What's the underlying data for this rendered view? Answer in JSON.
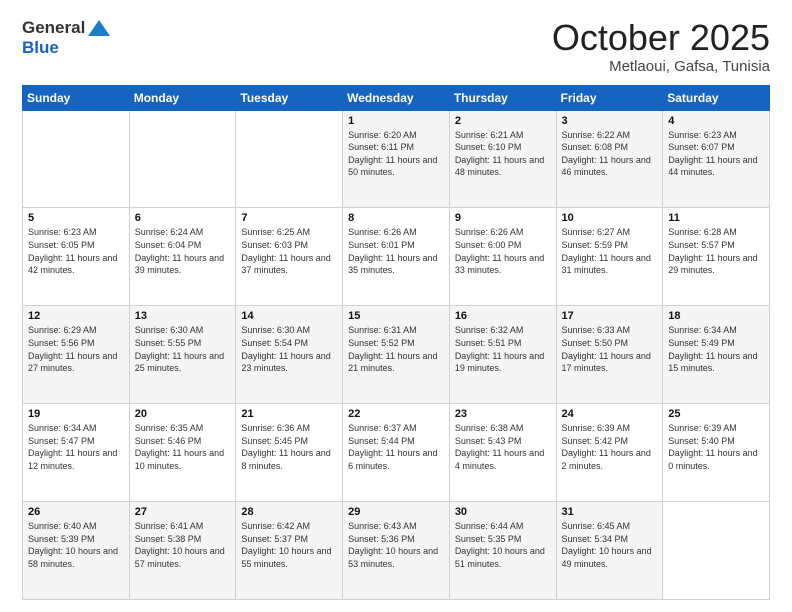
{
  "header": {
    "logo_general": "General",
    "logo_blue": "Blue",
    "month": "October 2025",
    "location": "Metlaoui, Gafsa, Tunisia"
  },
  "days_of_week": [
    "Sunday",
    "Monday",
    "Tuesday",
    "Wednesday",
    "Thursday",
    "Friday",
    "Saturday"
  ],
  "weeks": [
    [
      {
        "day": "",
        "sunrise": "",
        "sunset": "",
        "daylight": ""
      },
      {
        "day": "",
        "sunrise": "",
        "sunset": "",
        "daylight": ""
      },
      {
        "day": "",
        "sunrise": "",
        "sunset": "",
        "daylight": ""
      },
      {
        "day": "1",
        "sunrise": "Sunrise: 6:20 AM",
        "sunset": "Sunset: 6:11 PM",
        "daylight": "Daylight: 11 hours and 50 minutes."
      },
      {
        "day": "2",
        "sunrise": "Sunrise: 6:21 AM",
        "sunset": "Sunset: 6:10 PM",
        "daylight": "Daylight: 11 hours and 48 minutes."
      },
      {
        "day": "3",
        "sunrise": "Sunrise: 6:22 AM",
        "sunset": "Sunset: 6:08 PM",
        "daylight": "Daylight: 11 hours and 46 minutes."
      },
      {
        "day": "4",
        "sunrise": "Sunrise: 6:23 AM",
        "sunset": "Sunset: 6:07 PM",
        "daylight": "Daylight: 11 hours and 44 minutes."
      }
    ],
    [
      {
        "day": "5",
        "sunrise": "Sunrise: 6:23 AM",
        "sunset": "Sunset: 6:05 PM",
        "daylight": "Daylight: 11 hours and 42 minutes."
      },
      {
        "day": "6",
        "sunrise": "Sunrise: 6:24 AM",
        "sunset": "Sunset: 6:04 PM",
        "daylight": "Daylight: 11 hours and 39 minutes."
      },
      {
        "day": "7",
        "sunrise": "Sunrise: 6:25 AM",
        "sunset": "Sunset: 6:03 PM",
        "daylight": "Daylight: 11 hours and 37 minutes."
      },
      {
        "day": "8",
        "sunrise": "Sunrise: 6:26 AM",
        "sunset": "Sunset: 6:01 PM",
        "daylight": "Daylight: 11 hours and 35 minutes."
      },
      {
        "day": "9",
        "sunrise": "Sunrise: 6:26 AM",
        "sunset": "Sunset: 6:00 PM",
        "daylight": "Daylight: 11 hours and 33 minutes."
      },
      {
        "day": "10",
        "sunrise": "Sunrise: 6:27 AM",
        "sunset": "Sunset: 5:59 PM",
        "daylight": "Daylight: 11 hours and 31 minutes."
      },
      {
        "day": "11",
        "sunrise": "Sunrise: 6:28 AM",
        "sunset": "Sunset: 5:57 PM",
        "daylight": "Daylight: 11 hours and 29 minutes."
      }
    ],
    [
      {
        "day": "12",
        "sunrise": "Sunrise: 6:29 AM",
        "sunset": "Sunset: 5:56 PM",
        "daylight": "Daylight: 11 hours and 27 minutes."
      },
      {
        "day": "13",
        "sunrise": "Sunrise: 6:30 AM",
        "sunset": "Sunset: 5:55 PM",
        "daylight": "Daylight: 11 hours and 25 minutes."
      },
      {
        "day": "14",
        "sunrise": "Sunrise: 6:30 AM",
        "sunset": "Sunset: 5:54 PM",
        "daylight": "Daylight: 11 hours and 23 minutes."
      },
      {
        "day": "15",
        "sunrise": "Sunrise: 6:31 AM",
        "sunset": "Sunset: 5:52 PM",
        "daylight": "Daylight: 11 hours and 21 minutes."
      },
      {
        "day": "16",
        "sunrise": "Sunrise: 6:32 AM",
        "sunset": "Sunset: 5:51 PM",
        "daylight": "Daylight: 11 hours and 19 minutes."
      },
      {
        "day": "17",
        "sunrise": "Sunrise: 6:33 AM",
        "sunset": "Sunset: 5:50 PM",
        "daylight": "Daylight: 11 hours and 17 minutes."
      },
      {
        "day": "18",
        "sunrise": "Sunrise: 6:34 AM",
        "sunset": "Sunset: 5:49 PM",
        "daylight": "Daylight: 11 hours and 15 minutes."
      }
    ],
    [
      {
        "day": "19",
        "sunrise": "Sunrise: 6:34 AM",
        "sunset": "Sunset: 5:47 PM",
        "daylight": "Daylight: 11 hours and 12 minutes."
      },
      {
        "day": "20",
        "sunrise": "Sunrise: 6:35 AM",
        "sunset": "Sunset: 5:46 PM",
        "daylight": "Daylight: 11 hours and 10 minutes."
      },
      {
        "day": "21",
        "sunrise": "Sunrise: 6:36 AM",
        "sunset": "Sunset: 5:45 PM",
        "daylight": "Daylight: 11 hours and 8 minutes."
      },
      {
        "day": "22",
        "sunrise": "Sunrise: 6:37 AM",
        "sunset": "Sunset: 5:44 PM",
        "daylight": "Daylight: 11 hours and 6 minutes."
      },
      {
        "day": "23",
        "sunrise": "Sunrise: 6:38 AM",
        "sunset": "Sunset: 5:43 PM",
        "daylight": "Daylight: 11 hours and 4 minutes."
      },
      {
        "day": "24",
        "sunrise": "Sunrise: 6:39 AM",
        "sunset": "Sunset: 5:42 PM",
        "daylight": "Daylight: 11 hours and 2 minutes."
      },
      {
        "day": "25",
        "sunrise": "Sunrise: 6:39 AM",
        "sunset": "Sunset: 5:40 PM",
        "daylight": "Daylight: 11 hours and 0 minutes."
      }
    ],
    [
      {
        "day": "26",
        "sunrise": "Sunrise: 6:40 AM",
        "sunset": "Sunset: 5:39 PM",
        "daylight": "Daylight: 10 hours and 58 minutes."
      },
      {
        "day": "27",
        "sunrise": "Sunrise: 6:41 AM",
        "sunset": "Sunset: 5:38 PM",
        "daylight": "Daylight: 10 hours and 57 minutes."
      },
      {
        "day": "28",
        "sunrise": "Sunrise: 6:42 AM",
        "sunset": "Sunset: 5:37 PM",
        "daylight": "Daylight: 10 hours and 55 minutes."
      },
      {
        "day": "29",
        "sunrise": "Sunrise: 6:43 AM",
        "sunset": "Sunset: 5:36 PM",
        "daylight": "Daylight: 10 hours and 53 minutes."
      },
      {
        "day": "30",
        "sunrise": "Sunrise: 6:44 AM",
        "sunset": "Sunset: 5:35 PM",
        "daylight": "Daylight: 10 hours and 51 minutes."
      },
      {
        "day": "31",
        "sunrise": "Sunrise: 6:45 AM",
        "sunset": "Sunset: 5:34 PM",
        "daylight": "Daylight: 10 hours and 49 minutes."
      },
      {
        "day": "",
        "sunrise": "",
        "sunset": "",
        "daylight": ""
      }
    ]
  ]
}
